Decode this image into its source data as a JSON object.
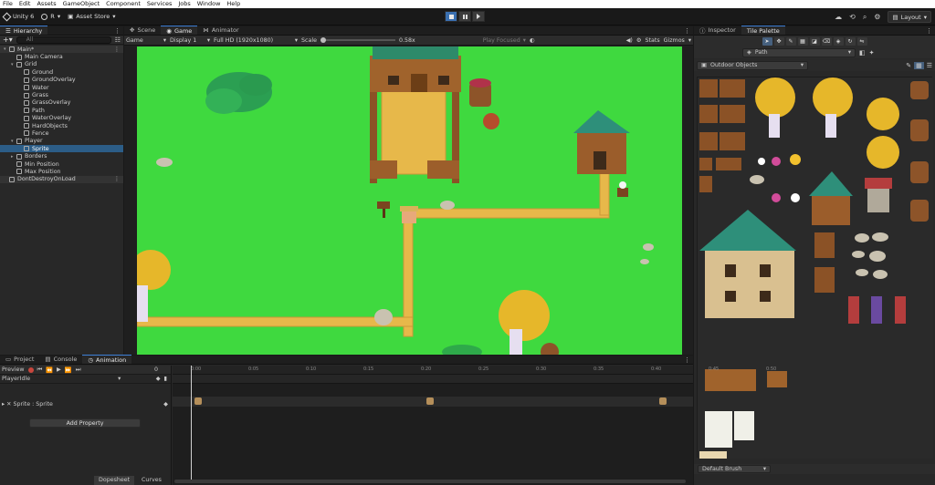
{
  "menu": [
    "File",
    "Edit",
    "Assets",
    "GameObject",
    "Component",
    "Services",
    "Jobs",
    "Window",
    "Help"
  ],
  "toolbar": {
    "unity_label": "Unity 6",
    "account_label": "R",
    "asset_store_label": "Asset Store",
    "layout_label": "Layout"
  },
  "hierarchy": {
    "tab_label": "Hierarchy",
    "search_placeholder": "All",
    "items": [
      {
        "label": "Main*",
        "depth": 1,
        "kind": "scene",
        "expanded": true
      },
      {
        "label": "Main Camera",
        "depth": 2,
        "kind": "object"
      },
      {
        "label": "Grid",
        "depth": 2,
        "kind": "object",
        "expanded": true
      },
      {
        "label": "Ground",
        "depth": 3,
        "kind": "object"
      },
      {
        "label": "GroundOverlay",
        "depth": 3,
        "kind": "object"
      },
      {
        "label": "Water",
        "depth": 3,
        "kind": "object"
      },
      {
        "label": "Grass",
        "depth": 3,
        "kind": "object"
      },
      {
        "label": "GrassOverlay",
        "depth": 3,
        "kind": "object"
      },
      {
        "label": "Path",
        "depth": 3,
        "kind": "object"
      },
      {
        "label": "WaterOverlay",
        "depth": 3,
        "kind": "object"
      },
      {
        "label": "HardObjects",
        "depth": 3,
        "kind": "object"
      },
      {
        "label": "Fence",
        "depth": 3,
        "kind": "object"
      },
      {
        "label": "Player",
        "depth": 2,
        "kind": "object",
        "expanded": true
      },
      {
        "label": "Sprite",
        "depth": 3,
        "kind": "object",
        "selected": true
      },
      {
        "label": "Borders",
        "depth": 2,
        "kind": "object"
      },
      {
        "label": "Min Position",
        "depth": 2,
        "kind": "object"
      },
      {
        "label": "Max Position",
        "depth": 2,
        "kind": "object"
      },
      {
        "label": "DontDestroyOnLoad",
        "depth": 1,
        "kind": "scene"
      }
    ]
  },
  "center_tabs": [
    {
      "label": "Scene",
      "active": false
    },
    {
      "label": "Game",
      "active": true
    },
    {
      "label": "Animator",
      "active": false
    }
  ],
  "gamebar": {
    "mode": "Game",
    "display": "Display 1",
    "resolution": "Full HD (1920x1080)",
    "scale_label": "Scale",
    "scale_value": "0.58x",
    "play_focused": "Play Focused",
    "stats": "Stats",
    "gizmos": "Gizmos"
  },
  "right_tabs": [
    {
      "label": "Inspector",
      "active": false
    },
    {
      "label": "Tile Palette",
      "active": true
    }
  ],
  "tile_palette": {
    "brush_target": "Path",
    "palette_name": "Outdoor Objects",
    "brush_label": "Default Brush"
  },
  "bottom_tabs": [
    {
      "label": "Project",
      "active": false
    },
    {
      "label": "Console",
      "active": false
    },
    {
      "label": "Animation",
      "active": true
    }
  ],
  "animation": {
    "preview_label": "Preview",
    "frame_value": "0",
    "clip_name": "PlayerIdle",
    "property_label": "Sprite : Sprite",
    "add_property_label": "Add Property",
    "dopesheet_label": "Dopesheet",
    "curves_label": "Curves",
    "ruler_ticks": [
      "0:00",
      "0:05",
      "0:10",
      "0:15",
      "0:20",
      "0:25",
      "0:30",
      "0:35",
      "0:40",
      "0:45",
      "0:50"
    ]
  },
  "colors": {
    "grass": "#3fd93f",
    "path": "#e7b84a",
    "accent": "#3d7fd6",
    "selection": "#2c5d87",
    "play_active": "#3a6fb0"
  }
}
